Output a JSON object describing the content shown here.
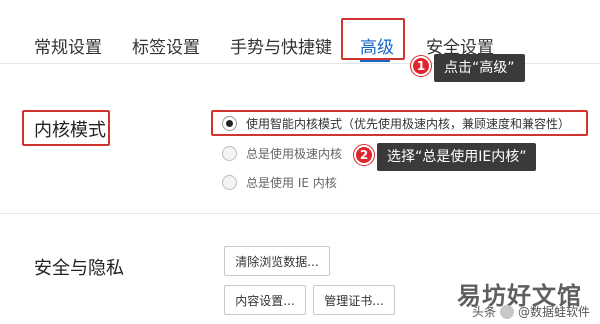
{
  "tabs": [
    {
      "label": "常规设置"
    },
    {
      "label": "标签设置"
    },
    {
      "label": "手势与快捷键"
    },
    {
      "label": "高级",
      "active": true
    },
    {
      "label": "安全设置"
    }
  ],
  "annotations": {
    "step1": {
      "number": "1",
      "text": "点击“高级”"
    },
    "step2": {
      "number": "2",
      "text": "选择“总是使用IE内核”"
    }
  },
  "kernel": {
    "label": "内核模式",
    "options": [
      {
        "label": "使用智能内核模式（优先使用极速内核，兼顾速度和兼容性）",
        "selected": true
      },
      {
        "label": "总是使用极速内核",
        "selected": false
      },
      {
        "label": "总是使用 IE 内核",
        "selected": false
      }
    ]
  },
  "security": {
    "label": "安全与隐私",
    "buttons": {
      "clear": "清除浏览数据...",
      "content": "内容设置...",
      "certs": "管理证书..."
    }
  },
  "watermark": {
    "main": "易坊好文馆",
    "platform": "头条",
    "author": "@数据蛙软件"
  },
  "colors": {
    "accent": "#1a67c8",
    "highlight": "#d3332f",
    "badge": "#e0242a",
    "tooltip": "#3a3a3a"
  }
}
